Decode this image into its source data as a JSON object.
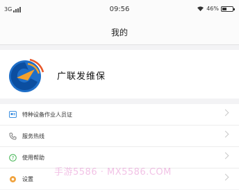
{
  "status_bar": {
    "network": "3G",
    "time": "09:56",
    "battery": "46%",
    "battery_level": 0.46
  },
  "nav": {
    "title": "我的"
  },
  "profile": {
    "name": "广联发维保",
    "logo_icon": "company-logo"
  },
  "menu": {
    "items": [
      {
        "label": "特种设备作业人员证",
        "icon": "certificate-icon",
        "color": "#3c8fe0"
      },
      {
        "label": "服务热线",
        "icon": "phone-icon",
        "color": "#7a7a7a"
      },
      {
        "label": "使用帮助",
        "icon": "help-icon",
        "color": "#3fb34f"
      },
      {
        "label": "设置",
        "icon": "settings-icon",
        "color": "#f0a23c"
      }
    ]
  },
  "watermark": {
    "text": "手游5586 · MX5586.COM"
  }
}
